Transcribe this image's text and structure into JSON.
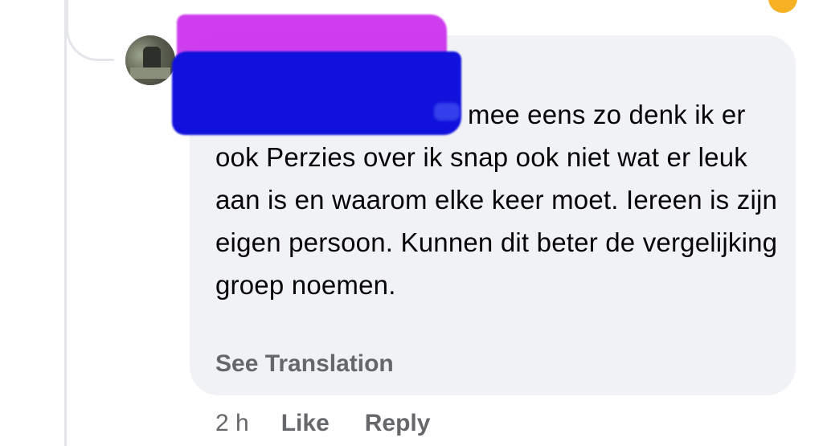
{
  "comment": {
    "author_redacted": true,
    "text_first_line": "mee eens zo denk ik",
    "text_rest": "er ook Perzies over ik snap ook niet wat er leuk aan is en waarom elke keer moet. Iereen is zijn eigen persoon. Kunnen dit beter de vergelijking groep noemen.",
    "see_translation": "See Translation"
  },
  "actions": {
    "time": "2 h",
    "like": "Like",
    "reply": "Reply"
  },
  "colors": {
    "bubble": "#f0f2f5",
    "text": "#050505",
    "muted": "#65676b",
    "redact_purple": "#cc33ee",
    "redact_blue": "#1111dd"
  },
  "icons": {
    "avatar": "user-avatar-photo",
    "reaction": "reaction-emoji-icon"
  }
}
